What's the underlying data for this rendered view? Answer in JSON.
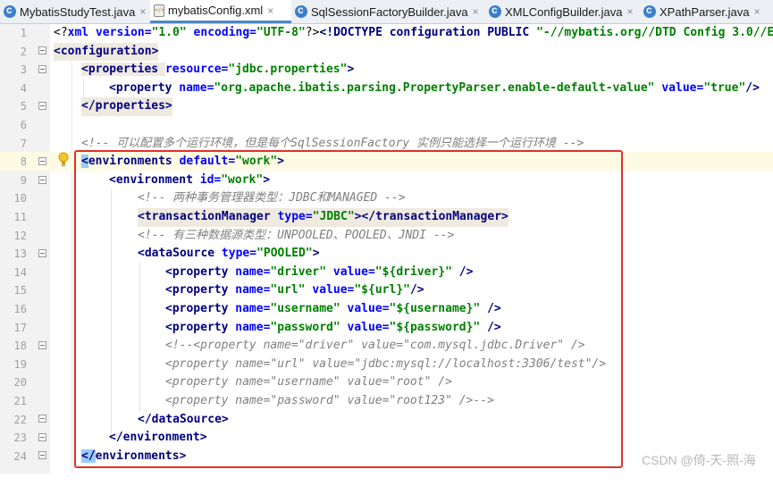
{
  "tabs": [
    {
      "label": "MybatisStudyTest.java",
      "icon": "java-class-icon"
    },
    {
      "label": "mybatisConfig.xml",
      "icon": "xml-file-icon",
      "active": true
    },
    {
      "label": "SqlSessionFactoryBuilder.java",
      "icon": "java-class-icon"
    },
    {
      "label": "XMLConfigBuilder.java",
      "icon": "java-class-icon"
    },
    {
      "label": "XPathParser.java",
      "icon": "java-class-icon"
    }
  ],
  "close_glyph": "×",
  "line_numbers": [
    "1",
    "2",
    "3",
    "4",
    "5",
    "6",
    "7",
    "8",
    "9",
    "10",
    "11",
    "12",
    "13",
    "14",
    "15",
    "16",
    "17",
    "18",
    "19",
    "20",
    "21",
    "22",
    "23",
    "24"
  ],
  "code": {
    "l1": [
      "<?",
      "xml version=",
      "\"1.0\"",
      " encoding=",
      "\"UTF-8\"",
      "?>",
      "<!DOCTYPE configuration PUBLIC ",
      "\"-//mybatis.org//DTD Config 3.0//E"
    ],
    "l2": [
      "<configuration>"
    ],
    "l3": [
      "<properties ",
      "resource=",
      "\"jdbc.properties\"",
      ">"
    ],
    "l4": [
      "<property ",
      "name=",
      "\"org.apache.ibatis.parsing.PropertyParser.enable-default-value\"",
      " value=",
      "\"true\"",
      "/>"
    ],
    "l5": [
      "</properties>"
    ],
    "l7": [
      "<!-- 可以配置多个运行环境，但是每个SqlSessionFactory 实例只能选择一个运行环境 -->"
    ],
    "l8": [
      "<",
      "environments",
      " default=",
      "\"work\"",
      ">"
    ],
    "l9": [
      "<environment ",
      "id=",
      "\"work\"",
      ">"
    ],
    "l10": [
      "<!-- 两种事务管理器类型：JDBC和MANAGED -->"
    ],
    "l11": [
      "<transactionManager ",
      "type=",
      "\"JDBC\"",
      "></transactionManager>"
    ],
    "l12": [
      "<!-- 有三种数据源类型：UNPOOLED、POOLED、JNDI -->"
    ],
    "l13": [
      "<dataSource ",
      "type=",
      "\"POOLED\"",
      ">"
    ],
    "l14": [
      "<property ",
      "name=",
      "\"driver\"",
      " value=",
      "\"${driver}\"",
      " />"
    ],
    "l15": [
      "<property ",
      "name=",
      "\"url\"",
      " value=",
      "\"${url}\"",
      "/>"
    ],
    "l16": [
      "<property ",
      "name=",
      "\"username\"",
      " value=",
      "\"${username}\"",
      " />"
    ],
    "l17": [
      "<property ",
      "name=",
      "\"password\"",
      " value=",
      "\"${password}\"",
      " />"
    ],
    "l18": [
      "<!--<property name=\"driver\" value=\"com.mysql.jdbc.Driver\" />"
    ],
    "l19": [
      "<property name=\"url\" value=\"jdbc:mysql://localhost:3306/test\"/>"
    ],
    "l20": [
      "<property name=\"username\" value=\"root\" />"
    ],
    "l21": [
      "<property name=\"password\" value=\"root123\" />-->"
    ],
    "l22": [
      "</dataSource>"
    ],
    "l23": [
      "</environment>"
    ],
    "l24": [
      "</",
      "environments",
      ">"
    ]
  },
  "watermark": "CSDN @倚-天-照-海",
  "colors": {
    "highlight_box": "#e2302b",
    "tag": "#000080",
    "attribute": "#0000ff",
    "value": "#008000",
    "comment": "#808080",
    "active_tab_underline": "#4a88c7"
  }
}
